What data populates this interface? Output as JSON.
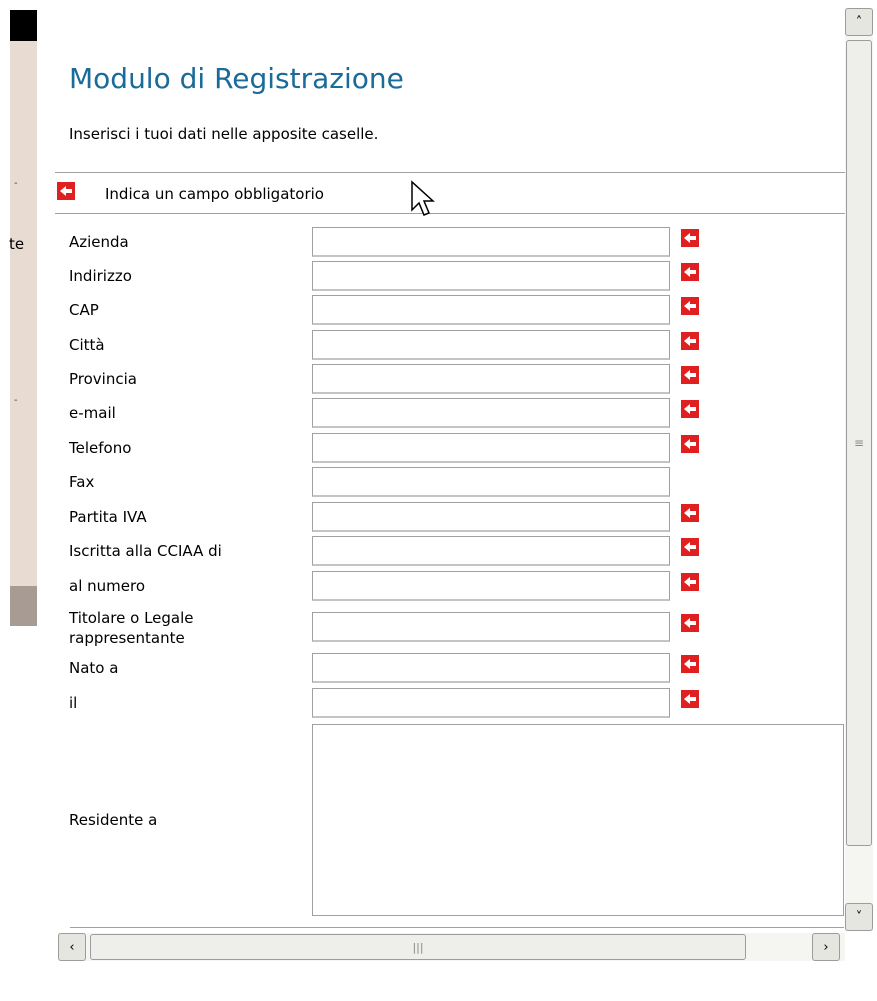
{
  "form": {
    "title": "Modulo di Registrazione",
    "intro": "Inserisci i tuoi dati nelle apposite caselle.",
    "required_note": "Indica un campo obbligatorio",
    "fields": [
      {
        "label": "Azienda",
        "required": true
      },
      {
        "label": "Indirizzo",
        "required": true
      },
      {
        "label": "CAP",
        "required": true
      },
      {
        "label": "Città",
        "required": true
      },
      {
        "label": "Provincia",
        "required": true
      },
      {
        "label": "e-mail",
        "required": true
      },
      {
        "label": "Telefono",
        "required": true
      },
      {
        "label": "Fax",
        "required": false
      },
      {
        "label": "Partita IVA",
        "required": true
      },
      {
        "label": "Iscritta alla CCIAA di",
        "required": true
      },
      {
        "label": "al numero",
        "required": true
      },
      {
        "label": "Titolare o Legale rappresentante",
        "required": true
      },
      {
        "label": "Nato a",
        "required": true
      },
      {
        "label": "il",
        "required": true
      }
    ],
    "residence_label": "Residente a"
  },
  "background_page": {
    "partial_text": "te"
  },
  "icons": {
    "required": "red-left-arrow-icon",
    "cursor": "mouse-pointer-icon"
  },
  "colors": {
    "title": "#1a6b9a",
    "required_icon": "#e02020"
  }
}
